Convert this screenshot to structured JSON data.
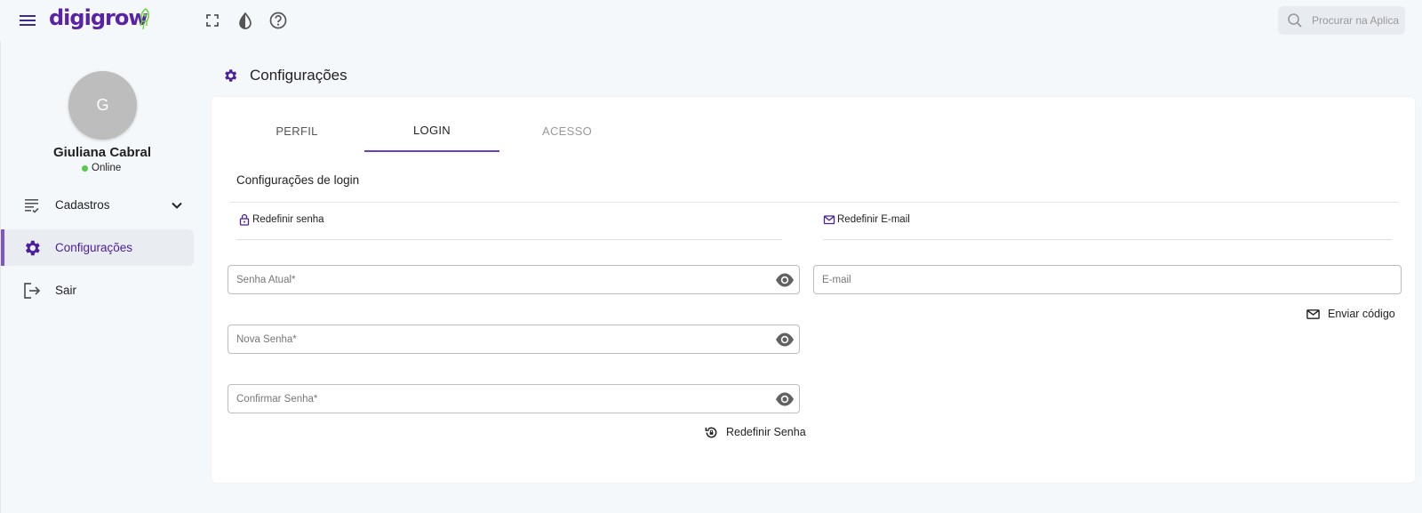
{
  "app": {
    "logo_text": "digigrow",
    "brand_color": "#5a22a8",
    "accent_color": "#7e57c2"
  },
  "header": {
    "search": {
      "placeholder": "Procurar na Aplicação",
      "value": ""
    },
    "icons": [
      "menu-icon",
      "fullscreen-icon",
      "contrast-icon",
      "help-icon"
    ]
  },
  "sidebar": {
    "avatar_initial": "G",
    "user_name": "Giuliana Cabral",
    "status": "Online",
    "status_color": "#5cc84a",
    "items": [
      {
        "label": "Cadastros",
        "icon": "list-check-icon",
        "expandable": true
      },
      {
        "label": "Configurações",
        "icon": "gear-icon",
        "active": true
      },
      {
        "label": "Sair",
        "icon": "logout-icon"
      }
    ]
  },
  "main": {
    "page_title": "Configurações",
    "tabs": [
      {
        "label": "PERFIL",
        "state": "normal"
      },
      {
        "label": "LOGIN",
        "state": "active"
      },
      {
        "label": "ACESSO",
        "state": "disabled"
      }
    ],
    "section_title": "Configurações de login",
    "password_panel": {
      "title": "Redefinir senha",
      "fields": [
        {
          "placeholder": "Senha Atual*",
          "value": ""
        },
        {
          "placeholder": "Nova Senha*",
          "value": ""
        },
        {
          "placeholder": "Confirmar Senha*",
          "value": ""
        }
      ],
      "submit_label": "Redefinir Senha"
    },
    "email_panel": {
      "title": "Redefinir E-mail",
      "field": {
        "placeholder": "E-mail",
        "value": ""
      },
      "submit_label": "Enviar código"
    }
  }
}
